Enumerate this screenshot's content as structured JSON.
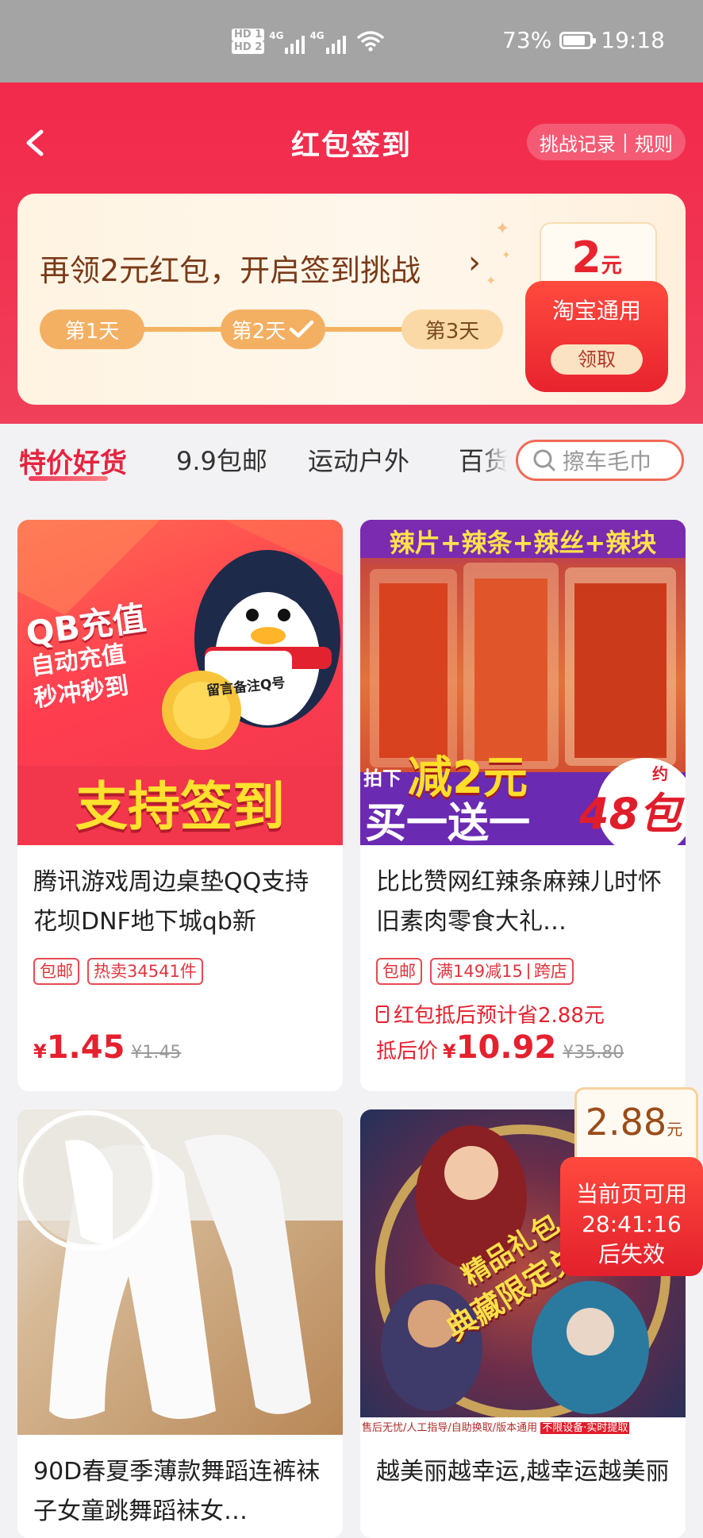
{
  "status_bar": {
    "sim1": "HD 1",
    "sim2": "HD 2",
    "net1": "4G",
    "net2": "4G",
    "battery": "73%",
    "time": "19:18"
  },
  "header": {
    "title": "红包签到",
    "records_link": "挑战记录",
    "rules_link": "规则",
    "separator": "|"
  },
  "challenge": {
    "text": "再领2元红包，开启签到挑战",
    "arrow": "›",
    "days": [
      "第1天",
      "第2天",
      "第3天"
    ],
    "day2_checked": true,
    "coupon": {
      "amount": "2",
      "unit": "元",
      "label": "淘宝通用",
      "button": "领取"
    }
  },
  "tabs": {
    "items": [
      "特价好货",
      "9.9包邮",
      "运动户外",
      "百货"
    ],
    "active_index": 0,
    "search_placeholder": "擦车毛巾"
  },
  "products": [
    {
      "title": "腾讯游戏周边桌垫QQ支持花坝DNF地下城qb新",
      "tags": [
        "包邮",
        "热卖34541件"
      ],
      "currency": "¥",
      "price": "1.45",
      "original_price": "¥1.45",
      "image": {
        "banner_top": "QB充值",
        "line2": "自动充值",
        "line3": "秒冲秒到",
        "badge": "留言备注Q号",
        "bottom": "支持签到"
      }
    },
    {
      "title": "比比赞网红辣条麻辣儿时怀旧素肉零食大礼…",
      "tags": [
        "包邮",
        "满149减15",
        "跨店"
      ],
      "save_text": "红包抵后预计省2.88元",
      "price_label": "抵后价",
      "currency": "¥",
      "price": "10.92",
      "original_price": "¥35.80",
      "image": {
        "top": "辣片+辣条+辣丝+辣块",
        "pick": "拍下",
        "discount": "减2元",
        "promo": "买一送一",
        "approx": "约",
        "count": "48包"
      }
    },
    {
      "title": "90D春夏季薄款舞蹈连裤袜子女童跳舞蹈袜女…"
    },
    {
      "title": "越美丽越幸运,越幸运越美丽",
      "image": {
        "ribbon1": "精品礼包",
        "ribbon2": "典藏限定兑",
        "footer": "售后无忧/人工指导/自助换取/版本通用",
        "footer_alert": "不限设备·实时提取"
      }
    }
  ],
  "floating_packet": {
    "amount": "2.88",
    "unit": "元",
    "line1": "当前页可用",
    "countdown": "28:41:16",
    "line3": "后失效"
  },
  "colors": {
    "brand_red": "#f2294b",
    "price_red": "#e5212f",
    "status_bar": "#a4a4a4"
  }
}
